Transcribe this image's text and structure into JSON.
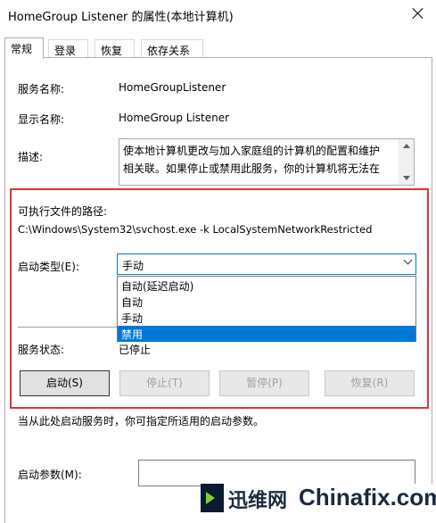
{
  "window": {
    "title": "HomeGroup Listener 的属性(本地计算机)"
  },
  "tabs": [
    {
      "label": "常规",
      "active": true
    },
    {
      "label": "登录"
    },
    {
      "label": "恢复"
    },
    {
      "label": "依存关系"
    }
  ],
  "general": {
    "service_name_label": "服务名称:",
    "service_name_value": "HomeGroupListener",
    "display_name_label": "显示名称:",
    "display_name_value": "HomeGroup Listener",
    "description_label": "描述:",
    "description_lines": [
      "使本地计算机更改与加入家庭组的计算机的配置和维护",
      "相关联。如果停止或禁用此服务，你的计算机将无法在"
    ],
    "exec_path_label": "可执行文件的路径:",
    "exec_path_value": "C:\\Windows\\System32\\svchost.exe -k LocalSystemNetworkRestricted",
    "startup_type_label": "启动类型(E):",
    "startup_type_value": "手动",
    "startup_options": [
      "自动(延迟启动)",
      "自动",
      "手动",
      "禁用"
    ],
    "startup_highlighted": "禁用",
    "service_status_label": "服务状态:",
    "service_status_value": "已停止",
    "buttons": {
      "start": "启动(S)",
      "stop": "停止(T)",
      "pause": "暂停(P)",
      "resume": "恢复(R)"
    },
    "hint_text": "当从此处启动服务时，你可指定所适用的启动参数。",
    "start_params_label": "启动参数(M):",
    "start_params_value": ""
  },
  "watermark": {
    "cn": "迅维网",
    "en": "Chinafix.com"
  },
  "colors": {
    "highlight": "#e0343a",
    "selection": "#0078d7"
  }
}
